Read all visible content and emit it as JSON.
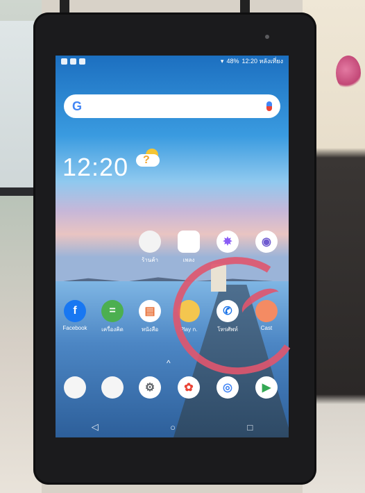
{
  "status_bar": {
    "battery": "48%",
    "time": "12:20 หลังเที่ยง"
  },
  "search": {
    "google_letter": "G"
  },
  "home": {
    "clock": "12:20",
    "row1": [
      {
        "label": "ร้านค้า",
        "color": "#f3f3f3",
        "icon": "app-folder-icon"
      },
      {
        "label": "เพลง",
        "color": "#ffffff",
        "icon": "app-icon"
      },
      {
        "label": "",
        "color": "#ffffff",
        "icon": "messenger-icon"
      },
      {
        "label": "",
        "color": "#ffffff",
        "icon": "camera-icon"
      }
    ],
    "row2": [
      {
        "label": "Facebook",
        "glyph": "f",
        "color": "#1877f2",
        "icon": "facebook-icon"
      },
      {
        "label": "เครื่องคิด",
        "glyph": "=",
        "color": "#4caf50",
        "icon": "calculator-icon"
      },
      {
        "label": "หนังสือ",
        "glyph": "",
        "color": "#e86f36",
        "icon": "book-icon"
      },
      {
        "label": "Play ก.",
        "glyph": "",
        "color": "#f4c64f",
        "icon": "games-icon"
      },
      {
        "label": "โทรศัพท์",
        "glyph": "✆",
        "color": "#1a73e8",
        "icon": "phone-icon"
      },
      {
        "label": "Cast",
        "glyph": "",
        "color": "#f48b63",
        "icon": "cast-icon"
      }
    ],
    "dock": [
      {
        "color": "#f5f5f5",
        "icon": "google-apps-folder-icon"
      },
      {
        "color": "#f5f5f5",
        "icon": "apps-folder-icon"
      },
      {
        "color": "#ffffff",
        "icon": "settings-icon"
      },
      {
        "color": "#ffffff",
        "icon": "photos-icon"
      },
      {
        "color": "#ffffff",
        "icon": "chrome-icon"
      },
      {
        "color": "#ffffff",
        "icon": "play-store-icon"
      }
    ],
    "drawer_arrow": "^"
  },
  "nav": {
    "back": "◁",
    "home": "○",
    "recents": "□"
  }
}
